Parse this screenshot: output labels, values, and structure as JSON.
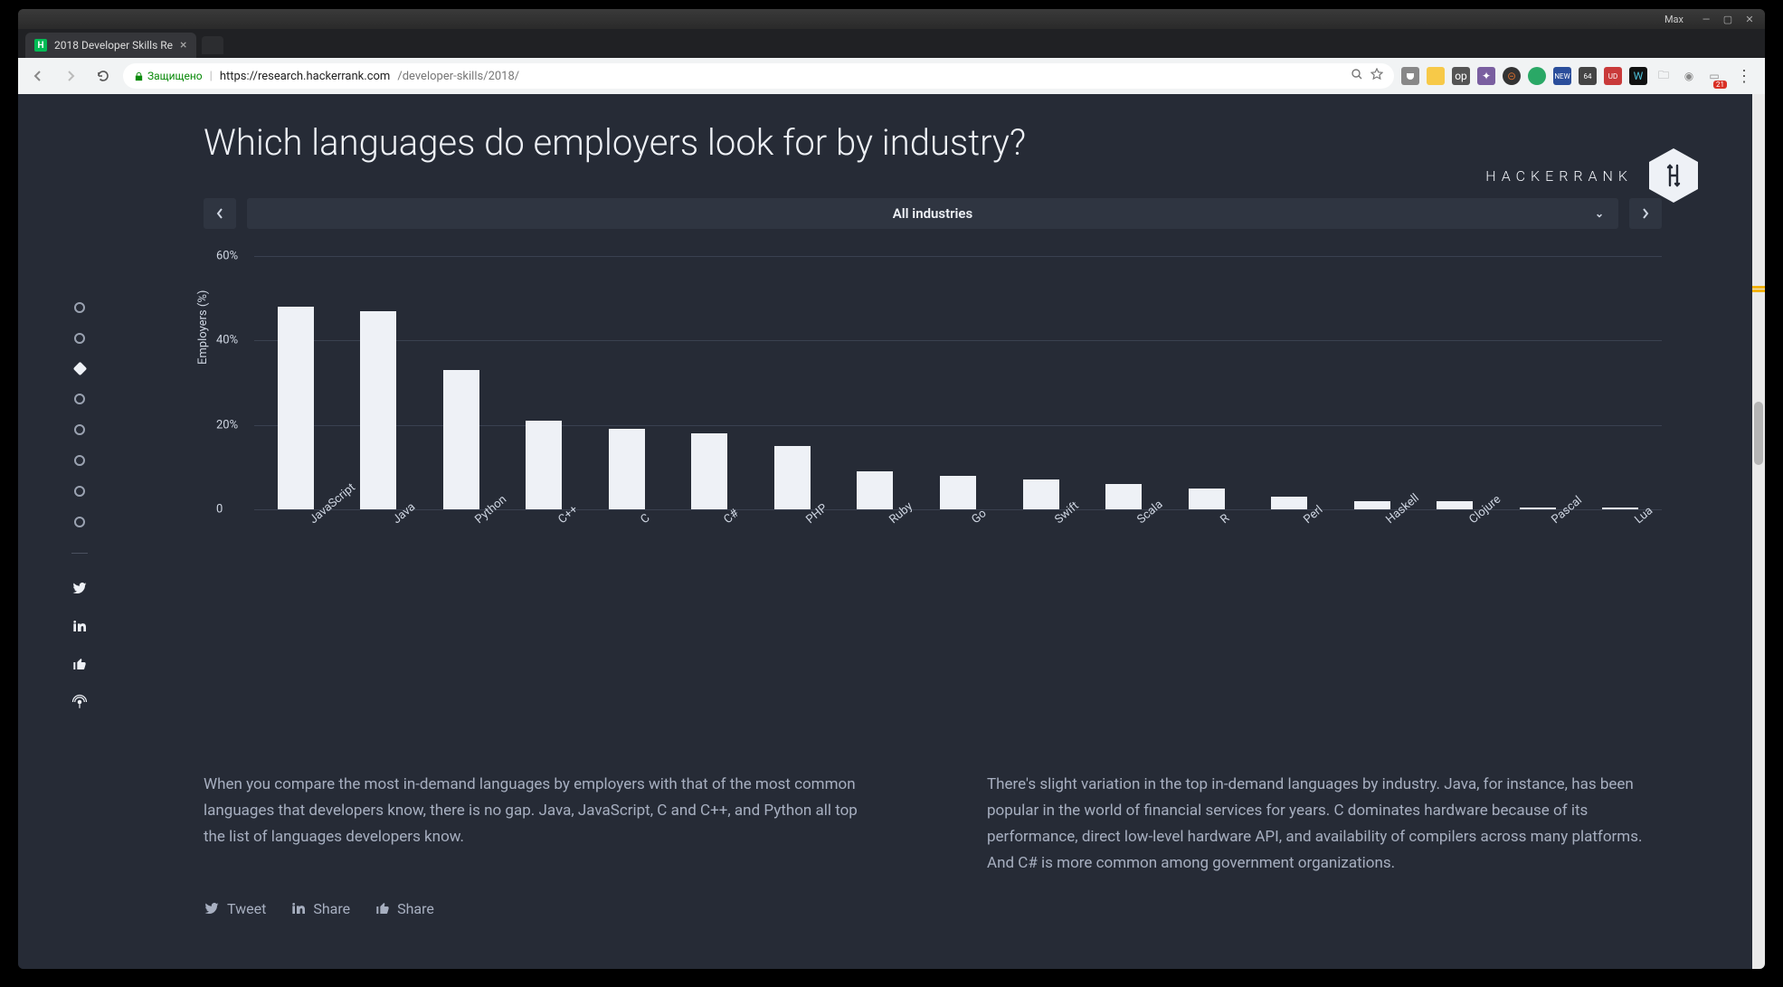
{
  "titlebar": {
    "user": "Max"
  },
  "tab": {
    "title": "2018 Developer Skills Re"
  },
  "omnibox": {
    "secure_label": "Защищено",
    "host": "https://research.hackerrank.com",
    "path": "/developer-skills/2018/"
  },
  "brand": {
    "text": "HACKERRANK"
  },
  "page": {
    "title": "Which languages do employers look for by industry?",
    "selector_label": "All industries",
    "paragraph_left": "When you compare the most in-demand languages by employers with that of the most common languages that developers know, there is no gap. Java, JavaScript, C and C++, and Python all top the list of languages developers know.",
    "paragraph_right": "There's slight variation in the top in-demand languages by industry. Java, for instance, has been popular in the world of financial services for years. C dominates hardware because of its performance, direct low-level hardware API, and availability of compilers across many platforms. And C# is more common among government organizations."
  },
  "share": {
    "tweet": "Tweet",
    "share1": "Share",
    "share2": "Share"
  },
  "ext_badge": "21",
  "chart_data": {
    "type": "bar",
    "title": "Which languages do employers look for by industry?",
    "ylabel": "Employers (%)",
    "xlabel": "",
    "ylim": [
      0,
      60
    ],
    "yticks": [
      0,
      20,
      40,
      60
    ],
    "categories": [
      "JavaScript",
      "Java",
      "Python",
      "C++",
      "C",
      "C#",
      "PHP",
      "Ruby",
      "Go",
      "Swift",
      "Scala",
      "R",
      "Perl",
      "Haskell",
      "Clojure",
      "Pascal",
      "Lua"
    ],
    "values": [
      48,
      47,
      33,
      21,
      19,
      18,
      15,
      9,
      8,
      7,
      6,
      5,
      3,
      2,
      2,
      0.5,
      0.5
    ]
  }
}
